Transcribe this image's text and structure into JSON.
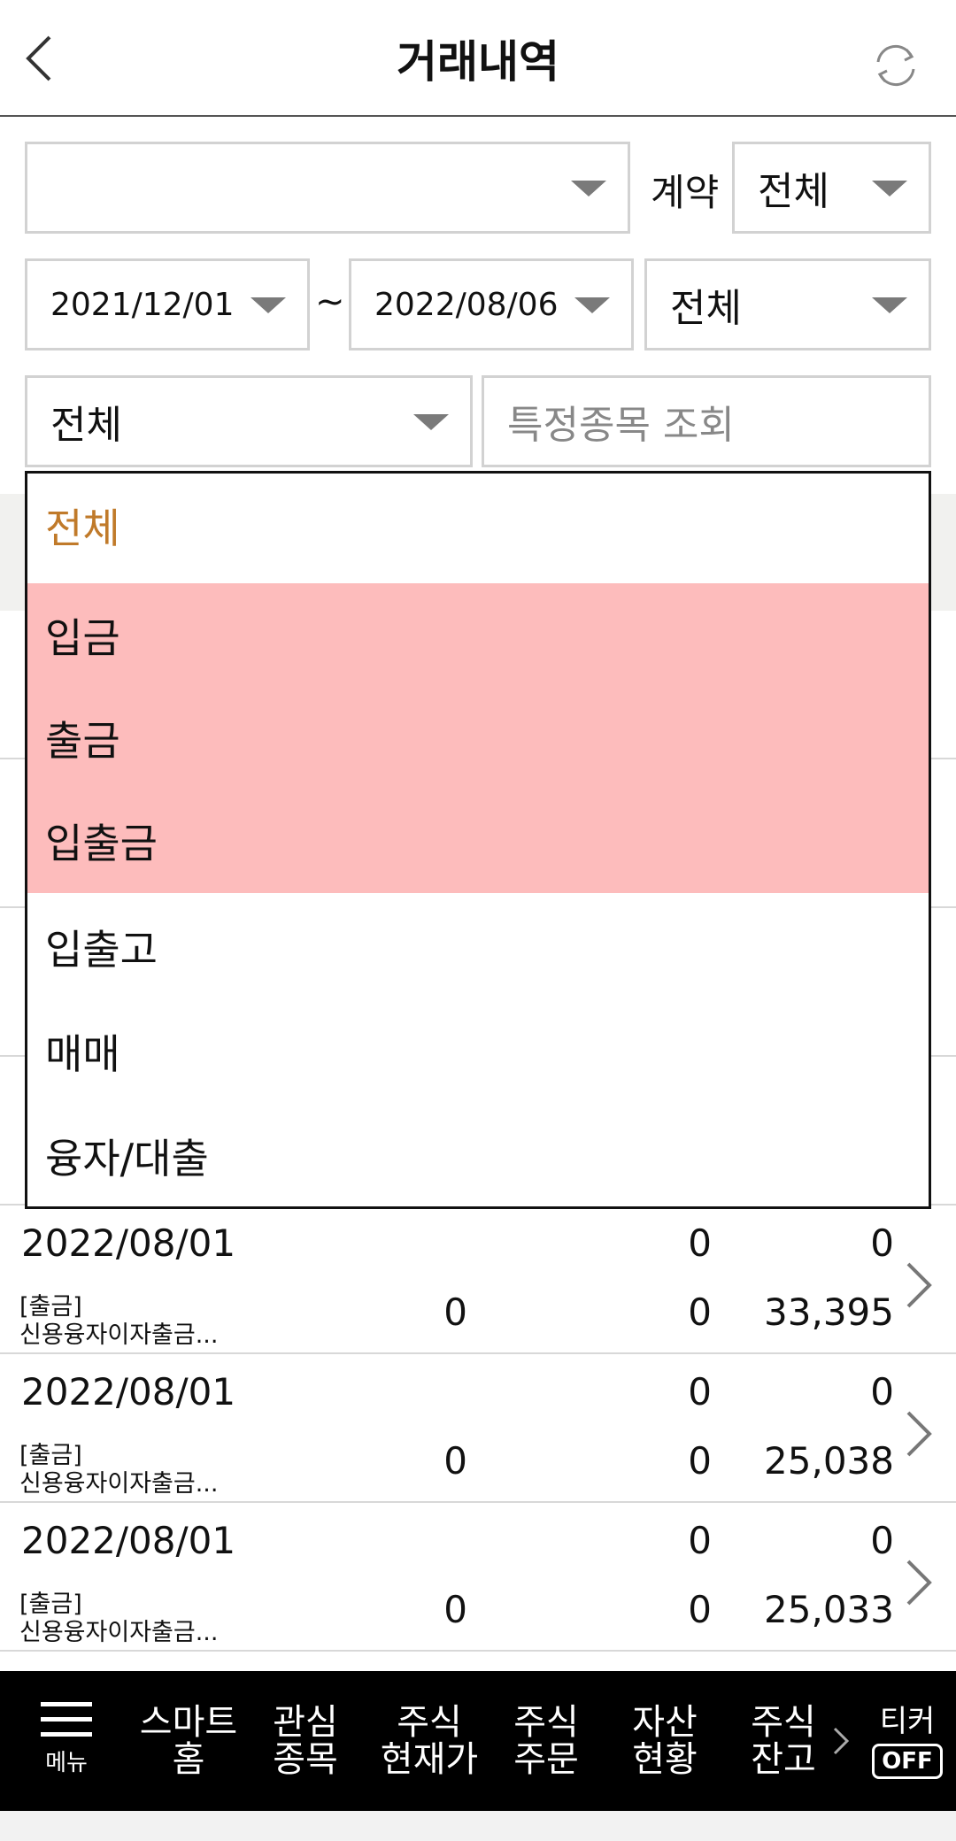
{
  "header": {
    "title": "거래내역",
    "back_icon": "chevron-left-icon",
    "refresh_icon": "refresh-icon"
  },
  "filters": {
    "account_value": "",
    "contract_label": "계약",
    "contract_value": "전체",
    "date_from": "2021/12/01",
    "date_separator": "~",
    "date_to": "2022/08/06",
    "period_type": "전체",
    "category_value": "전체",
    "search_placeholder": "특정종목 조회"
  },
  "dropdown": {
    "items": [
      {
        "label": "전체",
        "selected": true
      },
      {
        "label": "입금",
        "highlighted": true
      },
      {
        "label": "출금",
        "highlighted": true
      },
      {
        "label": "입출금",
        "highlighted": true
      },
      {
        "label": "입출고"
      },
      {
        "label": "매매"
      },
      {
        "label": "융자/대출"
      }
    ]
  },
  "rows": [
    {
      "date": "2022/08/01",
      "type": "[출금]",
      "desc": "신용융자이자출금...",
      "col2_bottom": "0",
      "col3_top": "0",
      "col3_bottom": "0",
      "col4_top": "0",
      "col4_bottom": "33,395"
    },
    {
      "date": "2022/08/01",
      "type": "[출금]",
      "desc": "신용융자이자출금...",
      "col2_bottom": "0",
      "col3_top": "0",
      "col3_bottom": "0",
      "col4_top": "0",
      "col4_bottom": "25,038"
    },
    {
      "date": "2022/08/01",
      "type": "[출금]",
      "desc": "신용융자이자출금...",
      "col2_bottom": "0",
      "col3_top": "0",
      "col3_bottom": "0",
      "col4_top": "0",
      "col4_bottom": "25,033"
    }
  ],
  "bottom_nav": {
    "menu_label": "메뉴",
    "items": [
      {
        "line1": "스마트",
        "line2": "홈"
      },
      {
        "line1": "관심",
        "line2": "종목"
      },
      {
        "line1": "주식",
        "line2": "현재가"
      },
      {
        "line1": "주식",
        "line2": "주문"
      },
      {
        "line1": "자산",
        "line2": "현황"
      },
      {
        "line1": "주식",
        "line2": "잔고"
      }
    ],
    "ticker_label": "티커",
    "ticker_state": "OFF"
  },
  "colors": {
    "selected_item": "#c07a2a",
    "highlight_bg": "#fdbcbc",
    "nav_bg": "#000000"
  }
}
